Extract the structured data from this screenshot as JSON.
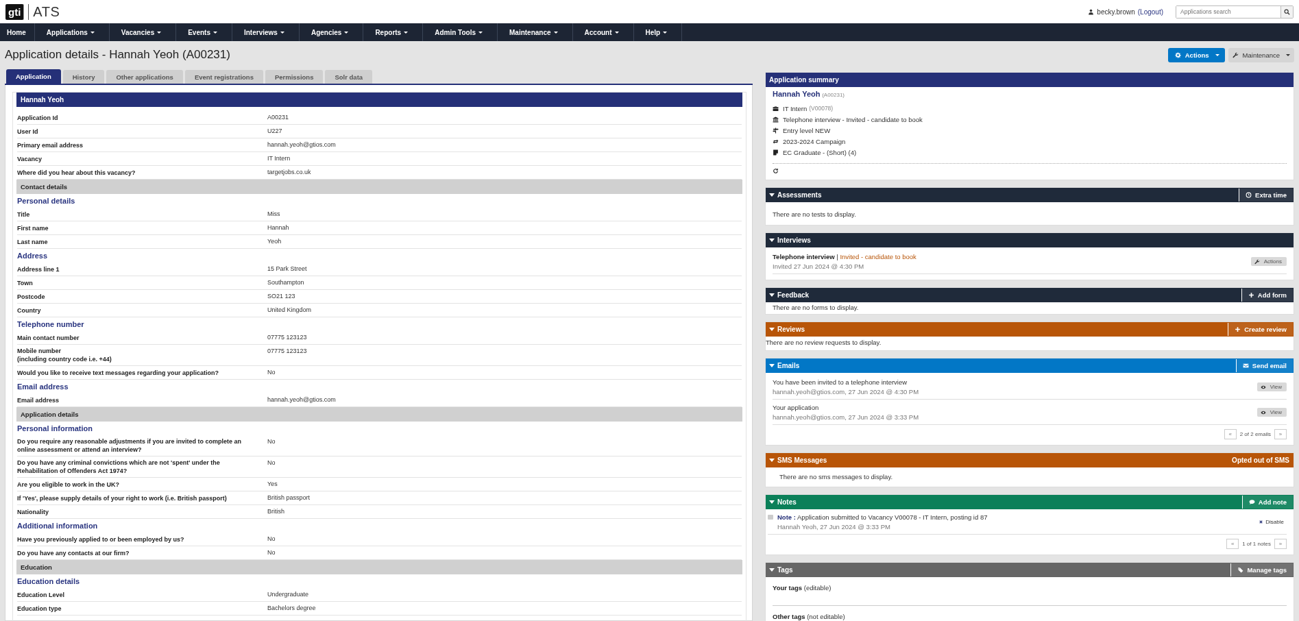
{
  "header": {
    "logo_mark": "gti",
    "app_name": "ATS",
    "user": "becky.brown",
    "logout": "(Logout)",
    "search": {
      "placeholder": "Applications search"
    }
  },
  "nav": [
    {
      "label": "Home",
      "dropdown": false
    },
    {
      "label": "Applications",
      "dropdown": true
    },
    {
      "label": "Vacancies",
      "dropdown": true
    },
    {
      "label": "Events",
      "dropdown": true
    },
    {
      "label": "Interviews",
      "dropdown": true
    },
    {
      "label": "Agencies",
      "dropdown": true
    },
    {
      "label": "Reports",
      "dropdown": true
    },
    {
      "label": "Admin Tools",
      "dropdown": true
    },
    {
      "label": "Maintenance",
      "dropdown": true
    },
    {
      "label": "Account",
      "dropdown": true
    },
    {
      "label": "Help",
      "dropdown": true
    }
  ],
  "page": {
    "title": "Application details - Hannah Yeoh (A00231)",
    "buttons": [
      {
        "kind": "primary",
        "label": "Actions"
      },
      {
        "kind": "secondary",
        "label": "Maintenance"
      }
    ]
  },
  "tabs": [
    {
      "label": "Application",
      "selected": true
    },
    {
      "label": "History",
      "selected": false
    },
    {
      "label": "Other applications",
      "selected": false
    },
    {
      "label": "Event registrations",
      "selected": false
    },
    {
      "label": "Permissions",
      "selected": false
    },
    {
      "label": "Solr data",
      "selected": false
    }
  ],
  "details": {
    "title": "Hannah Yeoh",
    "rows": [
      {
        "kind": "field",
        "label": "Application Id",
        "value": "A00231"
      },
      {
        "kind": "field",
        "label": "User Id",
        "value": "U227"
      },
      {
        "kind": "field",
        "label": "Primary email address",
        "value": "hannah.yeoh@gtios.com"
      },
      {
        "kind": "field",
        "label": "Vacancy",
        "value": "IT Intern"
      },
      {
        "kind": "field",
        "label": "Where did you hear about this vacancy?",
        "value": "targetjobs.co.uk"
      },
      {
        "kind": "section",
        "label": "Contact details"
      },
      {
        "kind": "subheading",
        "label": "Personal details"
      },
      {
        "kind": "field",
        "label": "Title",
        "value": "Miss"
      },
      {
        "kind": "field",
        "label": "First name",
        "value": "Hannah"
      },
      {
        "kind": "field",
        "label": "Last name",
        "value": "Yeoh"
      },
      {
        "kind": "subheading",
        "label": "Address"
      },
      {
        "kind": "field",
        "label": "Address line 1",
        "value": "15 Park Street"
      },
      {
        "kind": "field",
        "label": "Town",
        "value": "Southampton"
      },
      {
        "kind": "field",
        "label": "Postcode",
        "value": "SO21 123"
      },
      {
        "kind": "field",
        "label": "Country",
        "value": "United Kingdom"
      },
      {
        "kind": "subheading",
        "label": "Telephone number"
      },
      {
        "kind": "field",
        "label": "Main contact number",
        "value": "07775 123123"
      },
      {
        "kind": "field",
        "label": "Mobile number\n(including country code i.e. +44)",
        "value": "07775 123123"
      },
      {
        "kind": "field",
        "label": "Would you like to receive text messages regarding your application?",
        "value": "No"
      },
      {
        "kind": "subheading",
        "label": "Email address"
      },
      {
        "kind": "field",
        "label": "Email address",
        "value": "hannah.yeoh@gtios.com"
      },
      {
        "kind": "section",
        "label": "Application details"
      },
      {
        "kind": "subheading",
        "label": "Personal information"
      },
      {
        "kind": "field",
        "label": "Do you require any reasonable adjustments if you are invited to complete an\nonline assessment or attend an interview?",
        "value": "No"
      },
      {
        "kind": "field",
        "label": "Do you have any criminal convictions which are not 'spent' under the\nRehabilitation of Offenders Act 1974?",
        "value": "No"
      },
      {
        "kind": "field",
        "label": "Are you eligible to work in the UK?",
        "value": "Yes"
      },
      {
        "kind": "field",
        "label": "If 'Yes', please supply details of your right to work (i.e. British passport)",
        "value": "British passport"
      },
      {
        "kind": "field",
        "label": "Nationality",
        "value": "British"
      },
      {
        "kind": "subheading",
        "label": "Additional information"
      },
      {
        "kind": "field",
        "label": "Have you previously applied to or been employed by us?",
        "value": "No"
      },
      {
        "kind": "field",
        "label": "Do you have any contacts at our firm?",
        "value": "No"
      },
      {
        "kind": "section",
        "label": "Education"
      },
      {
        "kind": "subheading",
        "label": "Education details"
      },
      {
        "kind": "field",
        "label": "Education Level",
        "value": "Undergraduate"
      },
      {
        "kind": "field",
        "label": "Education type",
        "value": "Bachelors degree"
      }
    ]
  },
  "summary": {
    "title": "Application summary",
    "name": "Hannah Yeoh",
    "ref": "(A00231)",
    "lines": [
      {
        "kind": "vacancy",
        "text": "IT Intern",
        "detail": "(V00078)"
      },
      {
        "kind": "stage",
        "text": "Telephone interview - Invited - candidate to book"
      },
      {
        "kind": "level",
        "text": "Entry level NEW"
      },
      {
        "kind": "campaign",
        "text": "2023-2024 Campaign"
      },
      {
        "kind": "workflow",
        "text": "EC Graduate - (Short) (4)"
      }
    ]
  },
  "panels": [
    {
      "kind": "assessments",
      "title": "Assessments",
      "color": "#1f2a3a",
      "expanded": true,
      "button": "Extra time",
      "empty": "There are no tests to display."
    },
    {
      "kind": "interviews",
      "title": "Interviews",
      "color": "#1f2a3a",
      "expanded": true,
      "interviews": [
        {
          "title": "Telephone interview",
          "separator": "|",
          "status": "Invited - candidate to book",
          "date": "Invited 27 Jun 2024 @ 4:30 PM",
          "action": "Actions"
        }
      ]
    },
    {
      "kind": "feedback",
      "title": "Feedback",
      "color": "#1f2a3a",
      "expanded": true,
      "button": "Add form",
      "empty": "There are no forms to display."
    },
    {
      "kind": "reviews",
      "title": "Reviews",
      "color": "#b85508",
      "expanded": true,
      "button": "Create review",
      "empty": "There are no review requests to display."
    },
    {
      "kind": "emails",
      "title": "Emails",
      "color": "#0277c6",
      "expanded": true,
      "button": "Send email",
      "emails": [
        {
          "subject": "You have been invited to a telephone interview",
          "meta": "hannah.yeoh@gtios.com, 27 Jun 2024 @ 4:30 PM",
          "action": "View"
        },
        {
          "subject": "Your application",
          "meta": "hannah.yeoh@gtios.com, 27 Jun 2024 @ 3:33 PM",
          "action": "View"
        }
      ],
      "pager": {
        "prev": "«",
        "text": "2 of 2 emails",
        "next": "»"
      }
    },
    {
      "kind": "sms",
      "title": "SMS Messages",
      "color": "#b85508",
      "expanded": true,
      "status": "Opted out of SMS",
      "empty": "There are no sms messages to display."
    },
    {
      "kind": "notes",
      "title": "Notes",
      "color": "#0b8059",
      "expanded": true,
      "button": "Add note",
      "notes": [
        {
          "label": "Note :",
          "text": "Application submitted to Vacancy V00078 - IT Intern, posting id 87",
          "meta": "Hannah Yeoh, 27 Jun 2024 @ 3:33 PM",
          "action": "Disable"
        }
      ],
      "pager": {
        "prev": "«",
        "text": "1 of 1 notes",
        "next": "»"
      }
    },
    {
      "kind": "tags",
      "title": "Tags",
      "color": "#666666",
      "expanded": true,
      "button": "Manage tags",
      "groups": [
        {
          "label": "Your tags",
          "note": "(editable)"
        },
        {
          "label": "Other tags",
          "note": "(not editable)"
        }
      ]
    }
  ]
}
